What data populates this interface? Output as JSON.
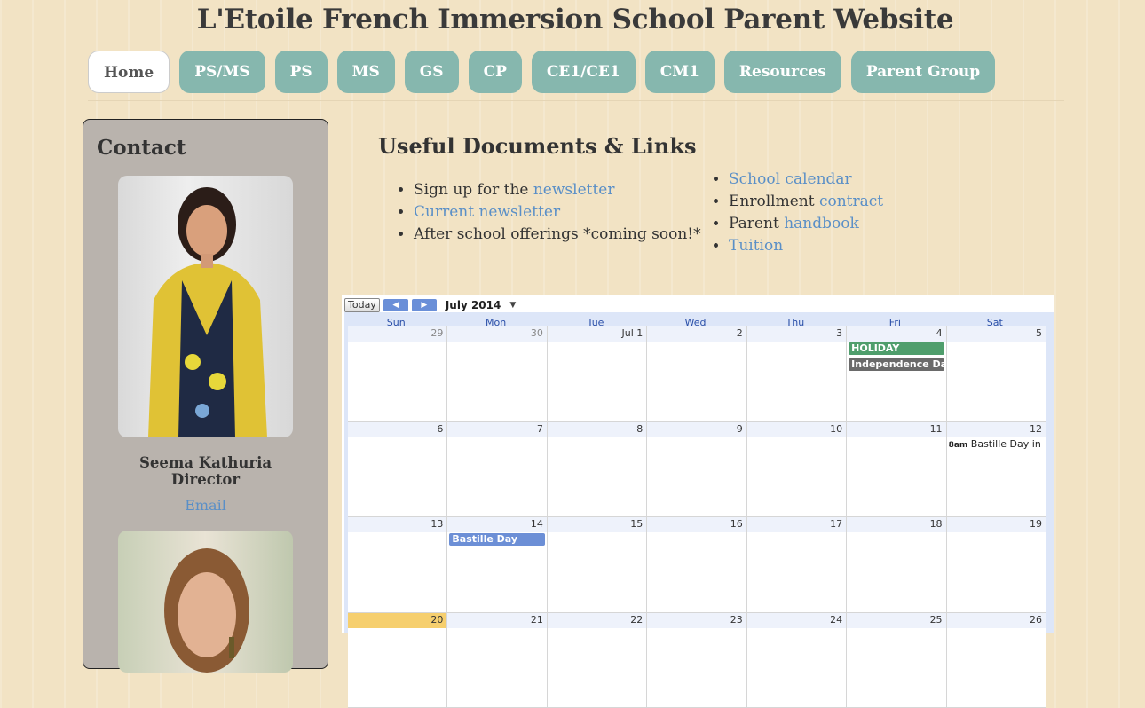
{
  "site": {
    "title": "L'Etoile French Immersion School Parent Website"
  },
  "nav": {
    "items": [
      "Home",
      "PS/MS",
      "PS",
      "MS",
      "GS",
      "CP",
      "CE1/CE1",
      "CM1",
      "Resources",
      "Parent Group"
    ]
  },
  "sidebar": {
    "heading": "Contact",
    "contacts": [
      {
        "name": "Seema Kathuria",
        "role": "Director",
        "link": "Email"
      }
    ]
  },
  "main": {
    "heading": "Useful Documents & Links",
    "left_list": [
      {
        "text": "Sign up for the ",
        "link": "newsletter"
      },
      {
        "text": "",
        "link": "Current newsletter"
      },
      {
        "text": "After school offerings *coming soon!*",
        "link": ""
      }
    ],
    "right_list": [
      {
        "text": "",
        "link": "School calendar"
      },
      {
        "text": "Enrollment ",
        "link": "contract"
      },
      {
        "text": "Parent ",
        "link": "handbook"
      },
      {
        "text": "",
        "link": "Tuition"
      }
    ]
  },
  "calendar": {
    "today_label": "Today",
    "month_label": "July 2014",
    "weekdays": [
      "Sun",
      "Mon",
      "Tue",
      "Wed",
      "Thu",
      "Fri",
      "Sat"
    ],
    "weeks": [
      [
        "29",
        "30",
        "Jul 1",
        "2",
        "3",
        "4",
        "5"
      ],
      [
        "6",
        "7",
        "8",
        "9",
        "10",
        "11",
        "12"
      ],
      [
        "13",
        "14",
        "15",
        "16",
        "17",
        "18",
        "19"
      ],
      [
        "20",
        "21",
        "22",
        "23",
        "24",
        "25",
        "26"
      ]
    ],
    "events": {
      "holiday": "HOLIDAY",
      "independence": "Independence Day",
      "bastille_time": "8am",
      "bastille_in": "Bastille Day in",
      "bastille": "Bastille Day"
    },
    "colors": {
      "holiday": "#4f9e6c",
      "independence": "#6a6a6a",
      "bastille": "#6c8fd6",
      "today": "#f6cf6e"
    }
  }
}
